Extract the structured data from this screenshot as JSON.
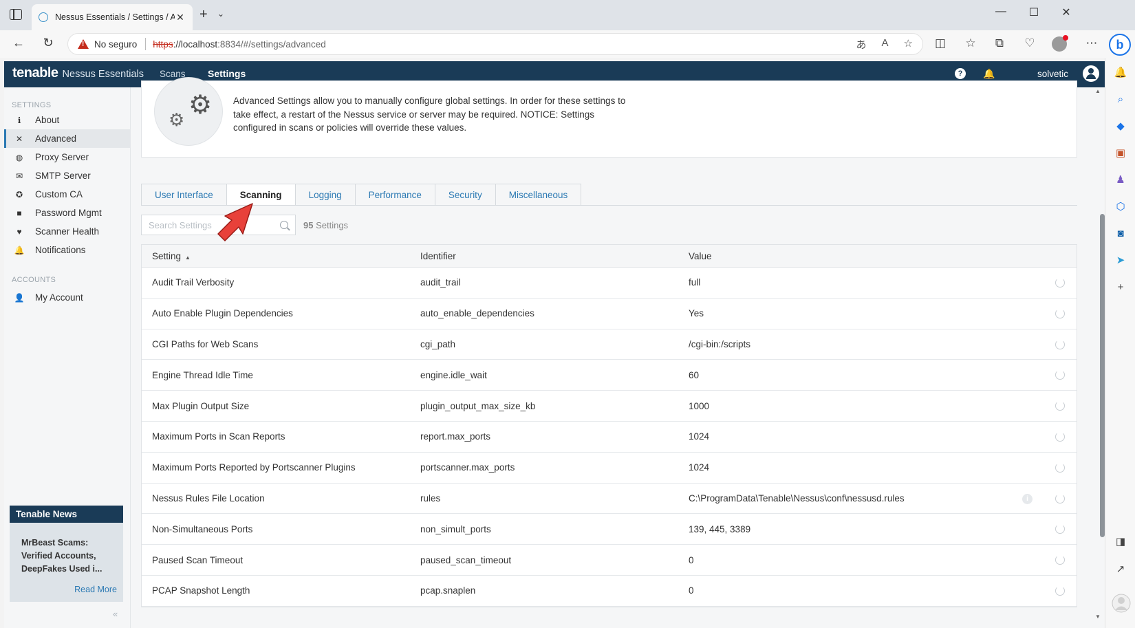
{
  "browser": {
    "tab_title": "Nessus Essentials / Settings / Adv",
    "insecure_label": "No seguro",
    "url_scheme": "https",
    "url_host": "://localhost",
    "url_port_path": ":8834/#/settings/advanced"
  },
  "topnav": {
    "brand": "tenable",
    "product": "Nessus Essentials",
    "scans": "Scans",
    "settings": "Settings",
    "username": "solvetic"
  },
  "leftnav": {
    "settings_header": "SETTINGS",
    "items": [
      {
        "label": "About"
      },
      {
        "label": "Advanced"
      },
      {
        "label": "Proxy Server"
      },
      {
        "label": "SMTP Server"
      },
      {
        "label": "Custom CA"
      },
      {
        "label": "Password Mgmt"
      },
      {
        "label": "Scanner Health"
      },
      {
        "label": "Notifications"
      }
    ],
    "accounts_header": "ACCOUNTS",
    "account_item": "My Account"
  },
  "news": {
    "header": "Tenable News",
    "headline": "MrBeast Scams: Verified Accounts, DeepFakes Used i...",
    "read_more": "Read More"
  },
  "info": {
    "text": "Advanced Settings allow you to manually configure global settings. In order for these settings to take effect, a restart of the Nessus service or server may be required. NOTICE: Settings configured in scans or policies will override these values."
  },
  "tabs": [
    "User Interface",
    "Scanning",
    "Logging",
    "Performance",
    "Security",
    "Miscellaneous"
  ],
  "search": {
    "placeholder": "Search Settings",
    "count_number": "95",
    "count_label": " Settings"
  },
  "table": {
    "headers": [
      "Setting",
      "Identifier",
      "Value"
    ],
    "rows": [
      {
        "setting": "Audit Trail Verbosity",
        "identifier": "audit_trail",
        "value": "full"
      },
      {
        "setting": "Auto Enable Plugin Dependencies",
        "identifier": "auto_enable_dependencies",
        "value": "Yes"
      },
      {
        "setting": "CGI Paths for Web Scans",
        "identifier": "cgi_path",
        "value": "/cgi-bin:/scripts"
      },
      {
        "setting": "Engine Thread Idle Time",
        "identifier": "engine.idle_wait",
        "value": "60"
      },
      {
        "setting": "Max Plugin Output Size",
        "identifier": "plugin_output_max_size_kb",
        "value": "1000"
      },
      {
        "setting": "Maximum Ports in Scan Reports",
        "identifier": "report.max_ports",
        "value": "1024"
      },
      {
        "setting": "Maximum Ports Reported by Portscanner Plugins",
        "identifier": "portscanner.max_ports",
        "value": "1024"
      },
      {
        "setting": "Nessus Rules File Location",
        "identifier": "rules",
        "value": "C:\\ProgramData\\Tenable\\Nessus\\conf\\nessusd.rules"
      },
      {
        "setting": "Non-Simultaneous Ports",
        "identifier": "non_simult_ports",
        "value": "139, 445, 3389"
      },
      {
        "setting": "Paused Scan Timeout",
        "identifier": "paused_scan_timeout",
        "value": "0"
      },
      {
        "setting": "PCAP Snapshot Length",
        "identifier": "pcap.snaplen",
        "value": "0"
      }
    ]
  }
}
